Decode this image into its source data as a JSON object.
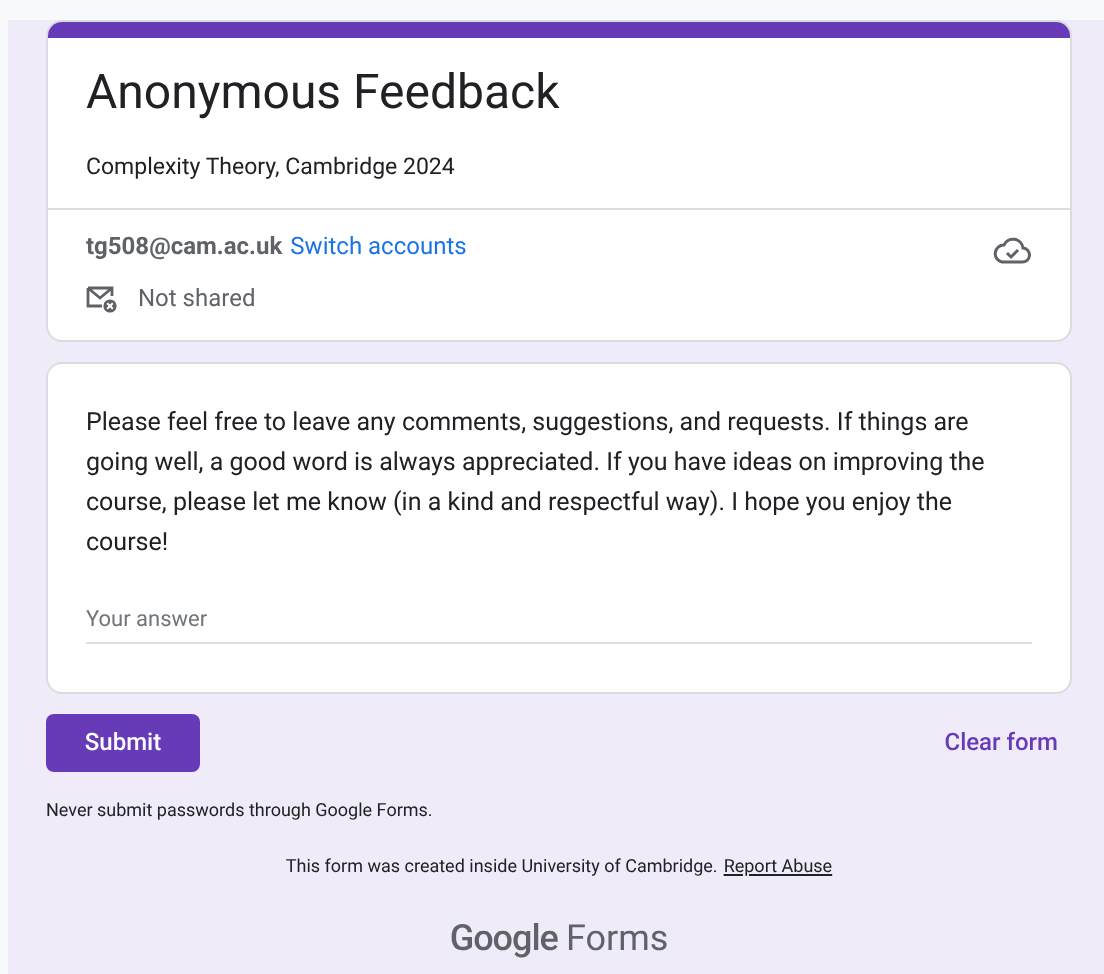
{
  "header": {
    "title": "Anonymous Feedback",
    "description": "Complexity Theory, Cambridge 2024"
  },
  "account": {
    "email": "tg508@cam.ac.uk",
    "switch_link": "Switch accounts",
    "sharing": "Not shared"
  },
  "question": {
    "text": "Please feel free to leave any comments, suggestions, and requests. If things are going well, a good word is always appreciated. If you have ideas on improving the course, please let me know (in a kind and respectful way). I hope you enjoy the course!",
    "placeholder": "Your answer"
  },
  "actions": {
    "submit": "Submit",
    "clear": "Clear form"
  },
  "footer": {
    "warning": "Never submit passwords through Google Forms.",
    "created": "This form was created inside University of Cambridge.",
    "report_link": "Report Abuse",
    "logo_brand": "Google",
    "logo_product": "Forms"
  }
}
